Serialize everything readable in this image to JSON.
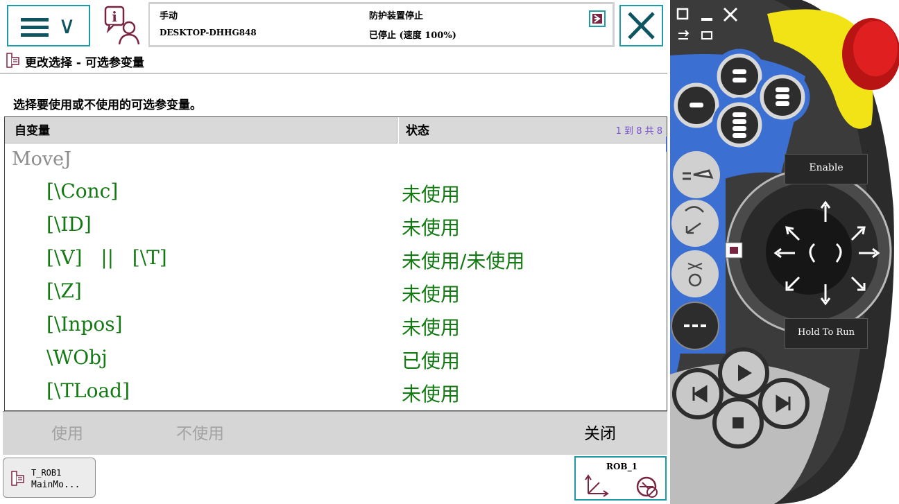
{
  "header": {
    "mode": "手动",
    "host": "DESKTOP-DHHG848",
    "guard_status": "防护装置停止",
    "run_status": "已停止 (速度 100%)"
  },
  "page": {
    "title": "更改选择 - 可选参变量",
    "instruction": "选择要使用或不使用的可选参变量。"
  },
  "table": {
    "columns": [
      "自变量",
      "状态"
    ],
    "count_label": "1 到 8 共 8",
    "instruction_name": "MoveJ",
    "rows": [
      {
        "argument": "[\\Conc]",
        "status": "未使用"
      },
      {
        "argument": "[\\ID]",
        "status": "未使用"
      },
      {
        "argument": "[\\V]   ||   [\\T]",
        "status": "未使用/未使用"
      },
      {
        "argument": "[\\Z]",
        "status": "未使用"
      },
      {
        "argument": "[\\Inpos]",
        "status": "未使用"
      },
      {
        "argument": "\\WObj",
        "status": "已使用"
      },
      {
        "argument": "[\\TLoad]",
        "status": "未使用"
      }
    ]
  },
  "commands": {
    "use": "使用",
    "not_use": "不使用",
    "close": "关闭"
  },
  "taskbar": {
    "task_line1": "T_ROB1",
    "task_line2": "MainMo...",
    "robot": "ROB_1"
  },
  "pendant": {
    "enable_label": "Enable",
    "hold_label": "Hold To Run"
  },
  "colors": {
    "accent": "#1c9ba6",
    "value_green": "#137a13",
    "count_purple": "#7a4fd0"
  }
}
